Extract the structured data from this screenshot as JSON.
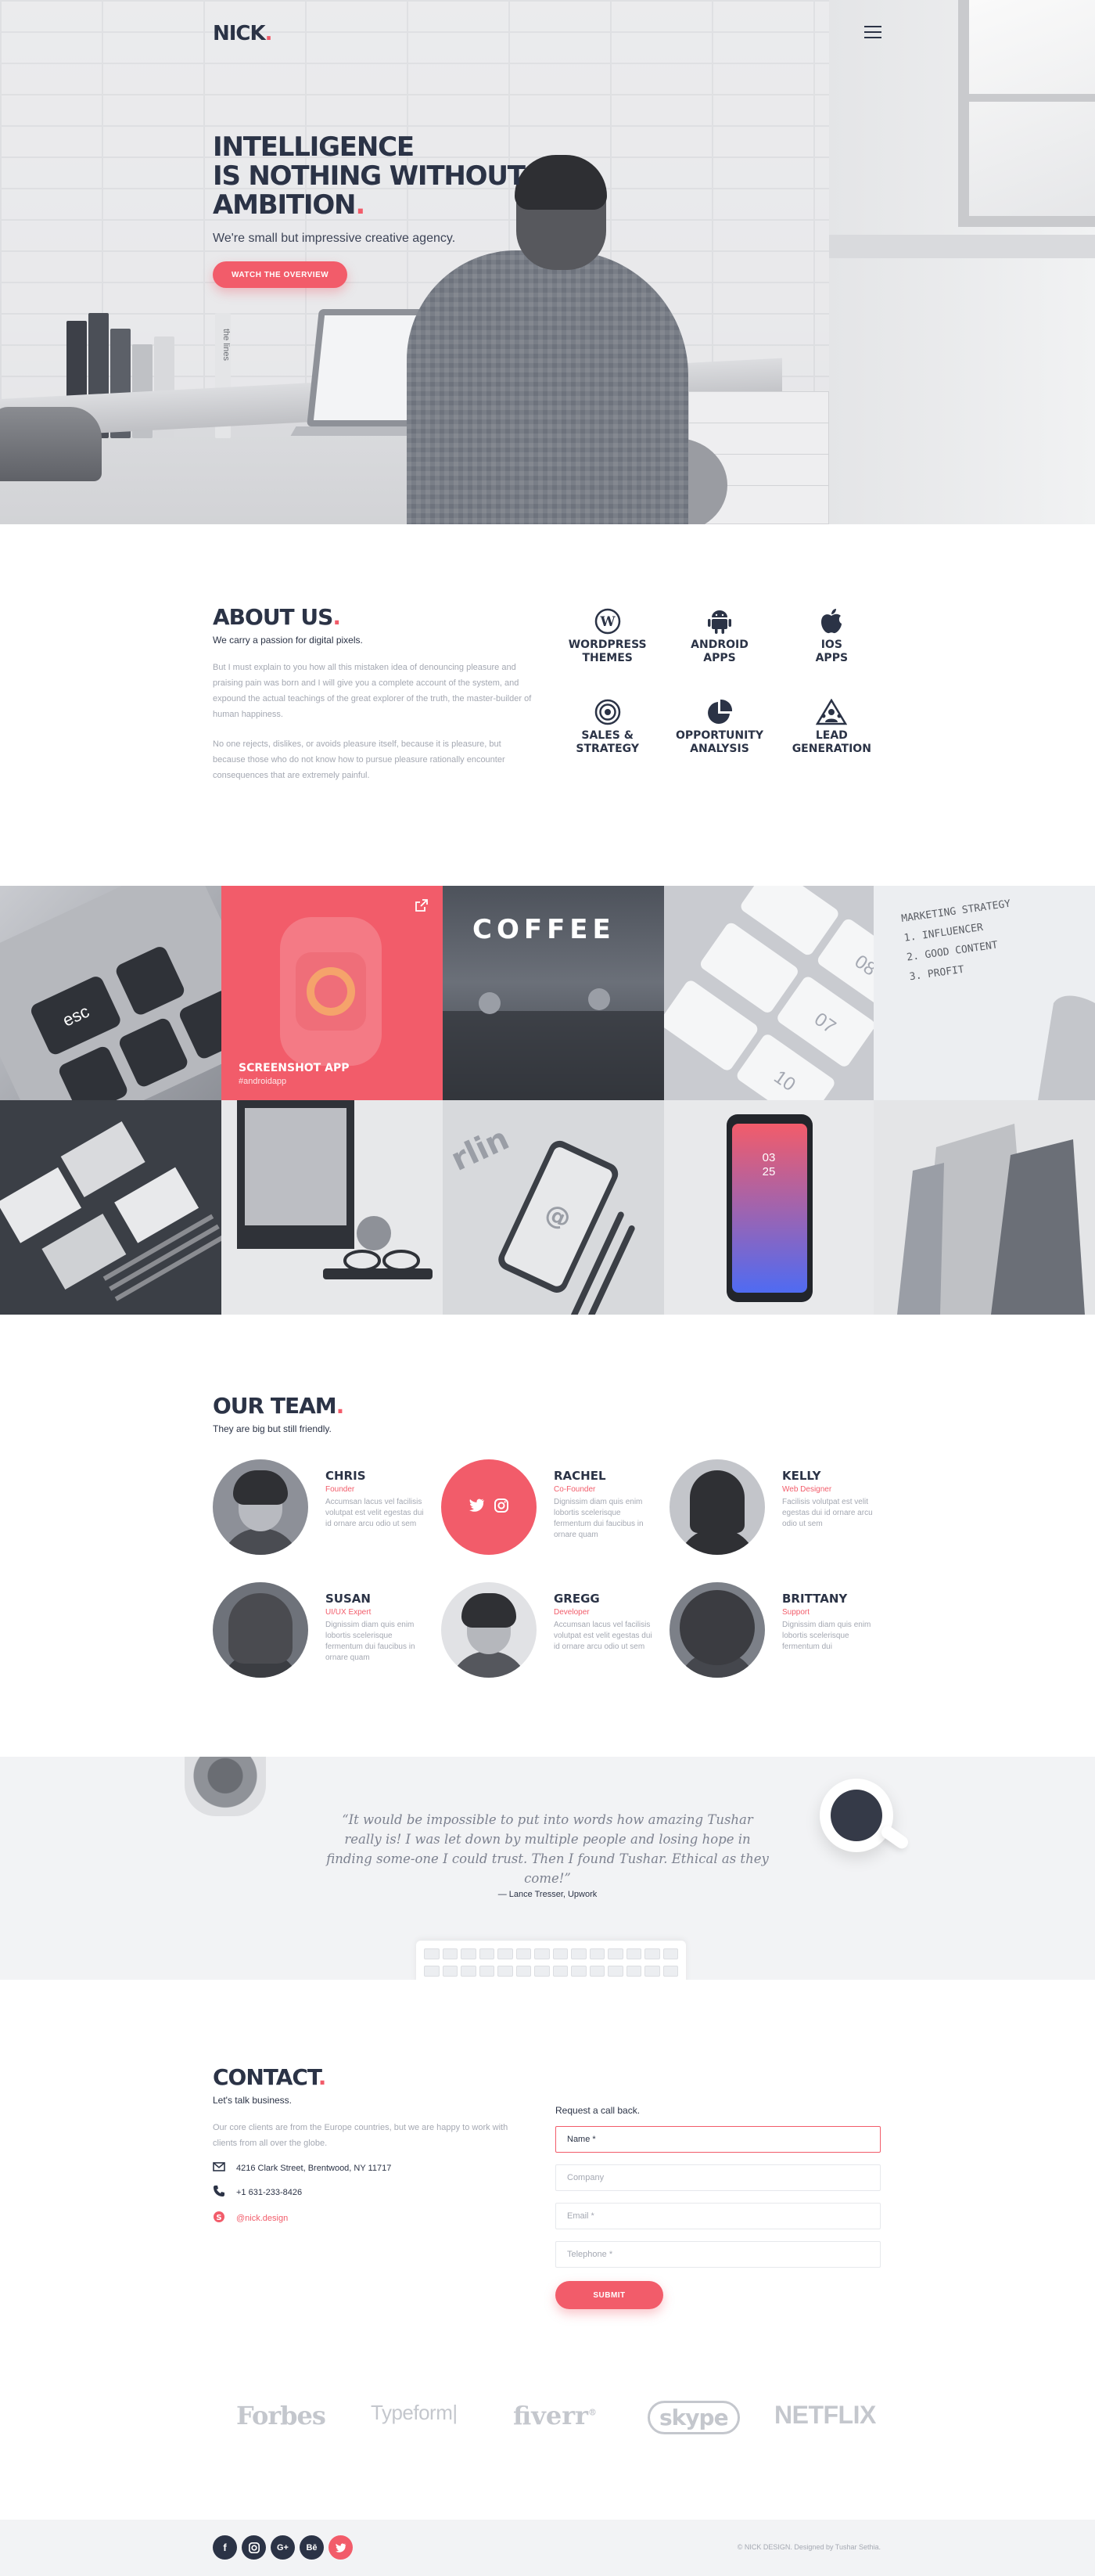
{
  "brand": {
    "name": "NICK",
    "dot": "."
  },
  "hero": {
    "title_lines": [
      "Intelligence",
      "is nothing without",
      "ambition"
    ],
    "title_dot": ".",
    "subtitle": "We're small but impressive creative agency.",
    "cta": "Watch the overview",
    "book_spine": "the lines"
  },
  "about": {
    "title": "About us",
    "dot": ".",
    "subtitle": "We carry a passion for digital pixels.",
    "para1": "But I must explain to you how all this mistaken idea of denouncing pleasure and praising pain was born and I will give you a complete account of the system, and expound the actual teachings of the great explorer of the truth, the master-builder of human happiness.",
    "para2": "No one rejects, dislikes, or avoids pleasure itself, because it is pleasure, but because those who do not know how to pursue pleasure rationally encounter consequences that are extremely painful.",
    "services": [
      {
        "label": "Wordpress\nthemes",
        "icon": "wordpress-icon"
      },
      {
        "label": "Android\napps",
        "icon": "android-icon"
      },
      {
        "label": "iOS\napps",
        "icon": "apple-icon"
      },
      {
        "label": "Sales &\nstrategy",
        "icon": "target-icon"
      },
      {
        "label": "Opportunity\nanalysis",
        "icon": "pie-chart-icon"
      },
      {
        "label": "Lead\ngeneration",
        "icon": "lead-icon"
      }
    ]
  },
  "portfolio": {
    "featured_title": "Screenshot app",
    "featured_subtitle": "#androidapp",
    "coffee_sign": "COFFEE",
    "key_label": "esc",
    "whiteboard_title": "MARKETING STRATEGY",
    "whiteboard_items": [
      "1. INFLUENCER",
      "2. GOOD CONTENT",
      "3. PROFIT"
    ],
    "phone_time": "03\n25",
    "cards": [
      "08",
      "07",
      "10"
    ],
    "sign_text": "rlin"
  },
  "team": {
    "title": "Our team",
    "dot": ".",
    "subtitle": "They are big but still friendly.",
    "members": [
      {
        "name": "Chris",
        "role": "Founder",
        "desc": "Accumsan lacus vel facilisis volutpat est velit egestas dui id ornare arcu odio ut sem"
      },
      {
        "name": "Rachel",
        "role": "Co-Founder",
        "desc": "Dignissim diam quis enim lobortis scelerisque fermentum dui faucibus in ornare quam"
      },
      {
        "name": "Kelly",
        "role": "Web Designer",
        "desc": "Facilisis volutpat est velit egestas dui id ornare arcu odio ut sem"
      },
      {
        "name": "Susan",
        "role": "UI/UX Expert",
        "desc": "Dignissim diam quis enim lobortis scelerisque fermentum dui faucibus in ornare quam"
      },
      {
        "name": "Gregg",
        "role": "Developer",
        "desc": "Accumsan lacus vel facilisis volutpat est velit egestas dui id ornare arcu odio ut sem"
      },
      {
        "name": "Brittany",
        "role": "Support",
        "desc": "Dignissim diam quis enim lobortis scelerisque fermentum dui"
      }
    ]
  },
  "testimonial": {
    "quote": "“It would be impossible to put into words how amazing Tushar really is! I was let down by multiple people and losing hope in finding some-one I could trust. Then I found Tushar. Ethical as they come!”",
    "author": "— Lance Tresser, Upwork"
  },
  "contact": {
    "title": "Contact",
    "dot": ".",
    "subtitle": "Let's talk business.",
    "text": "Our core clients are from the Europe countries, but we are happy to work with clients from all over the globe.",
    "address": "4216 Clark Street, Brentwood, NY 11717",
    "phone": "+1 631-233-8426",
    "skype": "@nick.design",
    "form_lead": "Request a call back.",
    "placeholders": {
      "name": "Name *",
      "company": "Company",
      "email": "Email *",
      "telephone": "Telephone *"
    },
    "submit": "Submit"
  },
  "clients": [
    "Forbes",
    "Typeform|",
    "fiverr",
    "skype",
    "NETFLIX"
  ],
  "clients_mark": "®",
  "footer": {
    "social": [
      "f",
      "ig",
      "G+",
      "Bē",
      "tw"
    ],
    "copyright": "© NICK DESIGN. Designed by Tushar Sethia."
  },
  "colors": {
    "accent": "#f25c6a",
    "navy": "#2b3346",
    "muted": "#a4a8b2",
    "light": "#f2f3f5"
  }
}
